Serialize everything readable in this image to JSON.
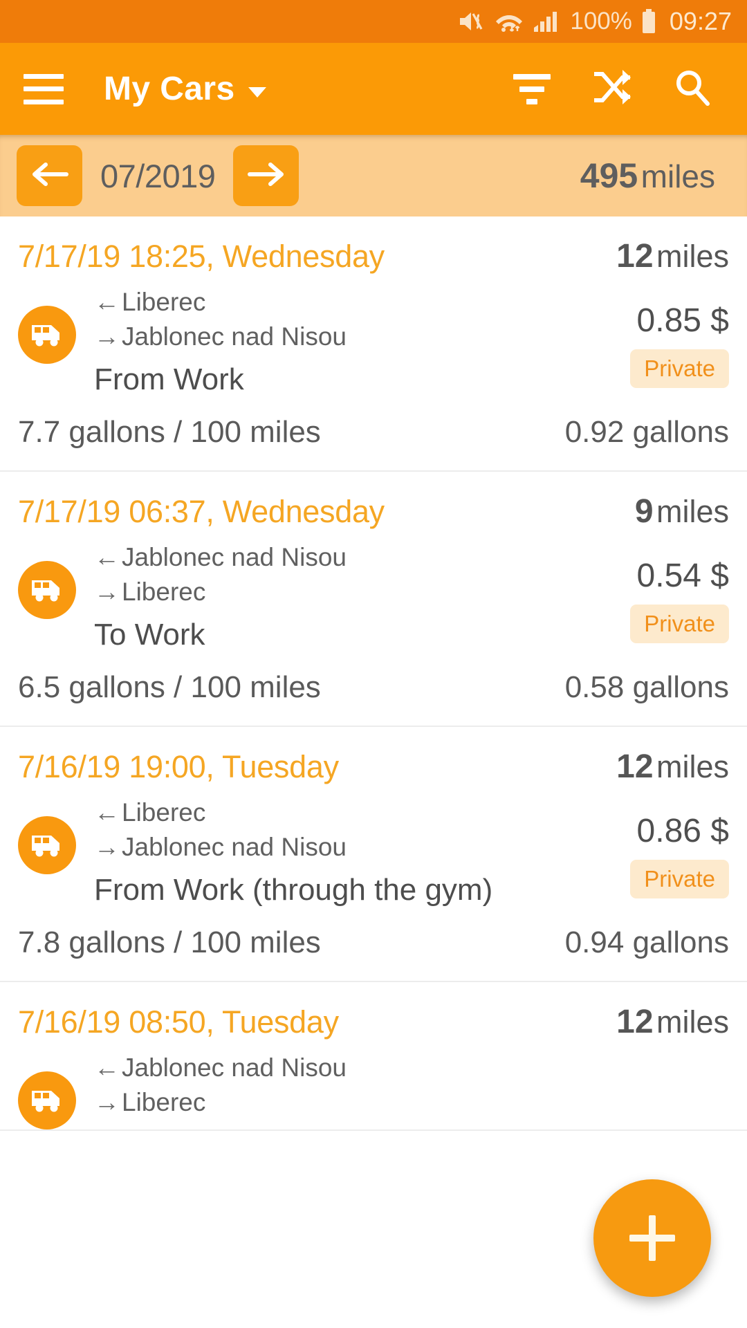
{
  "status_bar": {
    "mute_icon": "mute-vibrate-icon",
    "wifi_icon": "wifi-icon",
    "signal_icon": "cellular-signal-icon",
    "battery_percent": "100%",
    "battery_icon": "battery-full-icon",
    "clock": "09:27"
  },
  "app_bar": {
    "menu_icon": "hamburger-menu-icon",
    "title": "My Cars",
    "caret_icon": "chevron-down-icon",
    "filter_icon": "filter-icon",
    "sort_icon": "shuffle-sort-icon",
    "search_icon": "search-icon"
  },
  "month_bar": {
    "prev_icon": "arrow-left-icon",
    "next_icon": "arrow-right-icon",
    "month": "07/2019",
    "total_value": "495",
    "total_unit": "miles"
  },
  "trips": [
    {
      "date": "7/17/19 18:25, Wednesday",
      "distance_value": "12",
      "distance_unit": "miles",
      "vehicle_icon": "van-icon",
      "from_arrow": "←",
      "from": "Liberec",
      "to_arrow": "→",
      "to": "Jablonec nad Nisou",
      "name": "From Work",
      "price": "0.85 $",
      "badge": "Private",
      "consumption": "7.7 gallons / 100 miles",
      "fuel": "0.92 gallons"
    },
    {
      "date": "7/17/19 06:37, Wednesday",
      "distance_value": "9",
      "distance_unit": "miles",
      "vehicle_icon": "van-icon",
      "from_arrow": "←",
      "from": "Jablonec nad Nisou",
      "to_arrow": "→",
      "to": "Liberec",
      "name": "To Work",
      "price": "0.54 $",
      "badge": "Private",
      "consumption": "6.5 gallons / 100 miles",
      "fuel": "0.58 gallons"
    },
    {
      "date": "7/16/19 19:00, Tuesday",
      "distance_value": "12",
      "distance_unit": "miles",
      "vehicle_icon": "van-icon",
      "from_arrow": "←",
      "from": "Liberec",
      "to_arrow": "→",
      "to": "Jablonec nad Nisou",
      "name": "From Work (through the gym)",
      "price": "0.86 $",
      "badge": "Private",
      "consumption": "7.8 gallons / 100 miles",
      "fuel": "0.94 gallons"
    },
    {
      "date": "7/16/19 08:50, Tuesday",
      "distance_value": "12",
      "distance_unit": "miles",
      "vehicle_icon": "van-icon",
      "from_arrow": "←",
      "from": "Jablonec nad Nisou",
      "to_arrow": "→",
      "to": "Liberec",
      "name": "",
      "price": "",
      "badge": "",
      "consumption": "",
      "fuel": ""
    }
  ],
  "fab": {
    "icon": "plus-icon"
  },
  "colors": {
    "status_bar": "#ef7c0a",
    "app_bar": "#fb9a06",
    "month_bar": "#fbcd8e",
    "accent": "#f5a623",
    "badge_bg": "#fdeacd"
  }
}
